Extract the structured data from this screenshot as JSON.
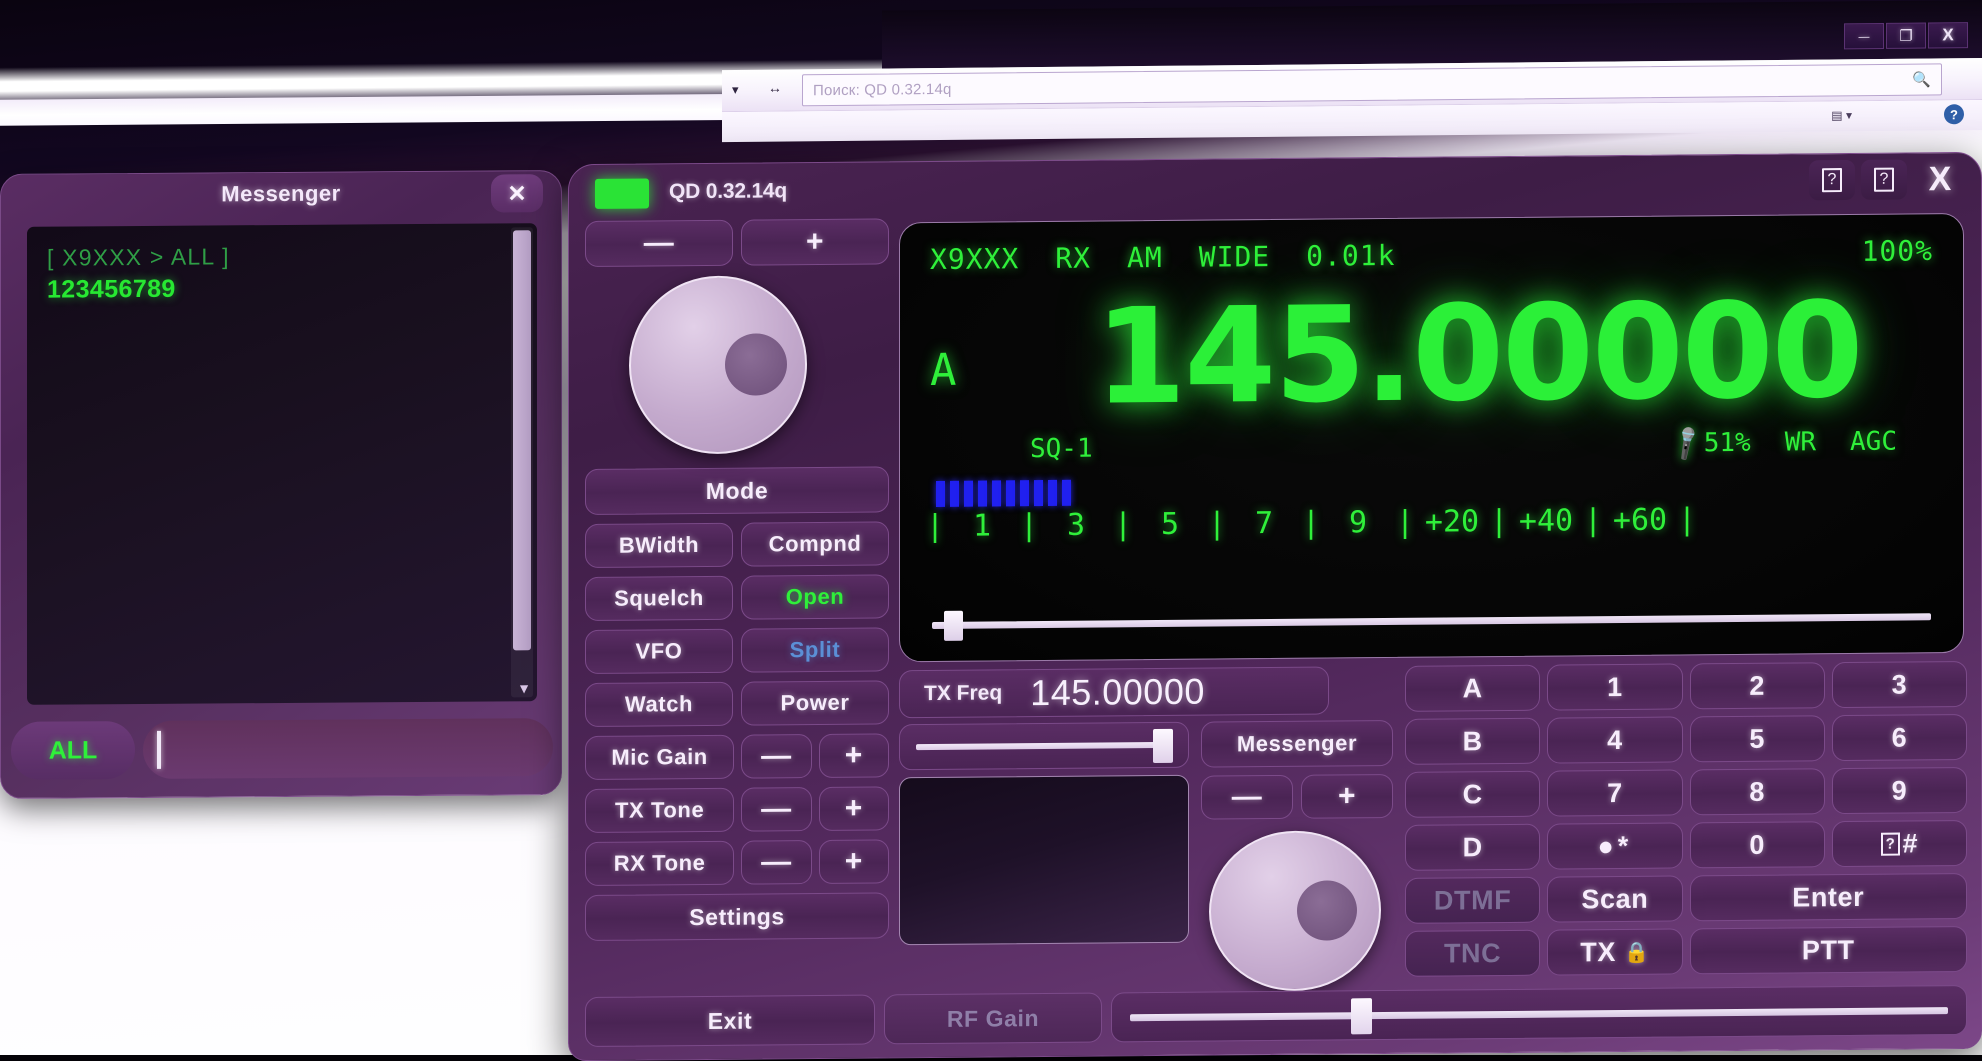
{
  "explorer": {
    "search_placeholder": "Поиск: QD 0.32.14q",
    "minimize_label": "—",
    "maximize_label": "❐",
    "close_label": "X",
    "dropdown_icon": "▾",
    "refresh_icon": "↔",
    "search_icon": "🔍",
    "view_icon": "▤ ▾",
    "help_icon": "?"
  },
  "messenger": {
    "title": "Messenger",
    "close_label": "✕",
    "log": [
      {
        "header": "[ X9XXX > ALL ]",
        "body": "123456789"
      }
    ],
    "destination": "ALL",
    "input_value": "",
    "scroll_arrow": "▼"
  },
  "radio": {
    "app_version": "QD 0.32.14q",
    "status_led_color": "#2ae336",
    "window_controls": [
      {
        "name": "help-1",
        "label": "?"
      },
      {
        "name": "help-2",
        "label": "?"
      },
      {
        "name": "close",
        "label": "X"
      }
    ],
    "top_buttons": {
      "decrement": "—",
      "increment": "+"
    },
    "controls": {
      "mode": "Mode",
      "bwidth": "BWidth",
      "compnd": "Compnd",
      "squelch": "Squelch",
      "squelch_value": "Open",
      "vfo": "VFO",
      "split": "Split",
      "watch": "Watch",
      "power": "Power",
      "mic_gain": "Mic Gain",
      "tx_tone": "TX Tone",
      "rx_tone": "RX Tone",
      "settings": "Settings",
      "minus": "—",
      "plus": "+"
    },
    "bottom": {
      "exit": "Exit",
      "rf_gain": "RF Gain",
      "rf_gain_percent": 28
    },
    "display": {
      "callsign": "X9XXX",
      "tr_state": "RX",
      "modulation": "AM",
      "bandwidth": "WIDE",
      "step": "0.01k",
      "battery": "100%",
      "vfo_letter": "A",
      "frequency": "145.00000",
      "squelch_level": "SQ-1",
      "mic_icon": "🎤",
      "mic_percent": "51%",
      "wr_flag": "WR",
      "agc_flag": "AGC",
      "volume_percent": 2,
      "smeter_bars": 10,
      "smeter_ticks": [
        "|",
        "1",
        "|",
        "3",
        "|",
        "5",
        "|",
        "7",
        "|",
        "9",
        "|",
        "+20",
        "|",
        "+40",
        "|",
        "+60",
        "|"
      ]
    },
    "tx": {
      "label": "TX Freq",
      "frequency": "145.00000",
      "slider_percent": 88
    },
    "messenger_button": "Messenger",
    "right_steppers": {
      "minus": "—",
      "plus": "+"
    },
    "keypad": [
      {
        "name": "key-a",
        "label": "A",
        "dim": false
      },
      {
        "name": "key-1",
        "label": "1",
        "dim": false
      },
      {
        "name": "key-2",
        "label": "2",
        "dim": false
      },
      {
        "name": "key-3",
        "label": "3",
        "dim": false
      },
      {
        "name": "key-b",
        "label": "B",
        "dim": false
      },
      {
        "name": "key-4",
        "label": "4",
        "dim": false
      },
      {
        "name": "key-5",
        "label": "5",
        "dim": false
      },
      {
        "name": "key-6",
        "label": "6",
        "dim": false
      },
      {
        "name": "key-c",
        "label": "C",
        "dim": false
      },
      {
        "name": "key-7",
        "label": "7",
        "dim": false
      },
      {
        "name": "key-8",
        "label": "8",
        "dim": false
      },
      {
        "name": "key-9",
        "label": "9",
        "dim": false
      },
      {
        "name": "key-d",
        "label": "D",
        "dim": false
      },
      {
        "name": "key-star",
        "label": "●*",
        "dim": false
      },
      {
        "name": "key-0",
        "label": "0",
        "dim": false
      },
      {
        "name": "key-hash",
        "label": "#",
        "dim": false
      },
      {
        "name": "key-dtmf",
        "label": "DTMF",
        "dim": true
      },
      {
        "name": "key-scan",
        "label": "Scan",
        "dim": false
      },
      {
        "name": "key-enter",
        "label": "Enter",
        "dim": false
      },
      {
        "name": "key-tnc",
        "label": "TNC",
        "dim": true
      },
      {
        "name": "key-tx",
        "label": "TX",
        "dim": false
      },
      {
        "name": "key-ptt",
        "label": "PTT",
        "dim": false
      }
    ]
  }
}
